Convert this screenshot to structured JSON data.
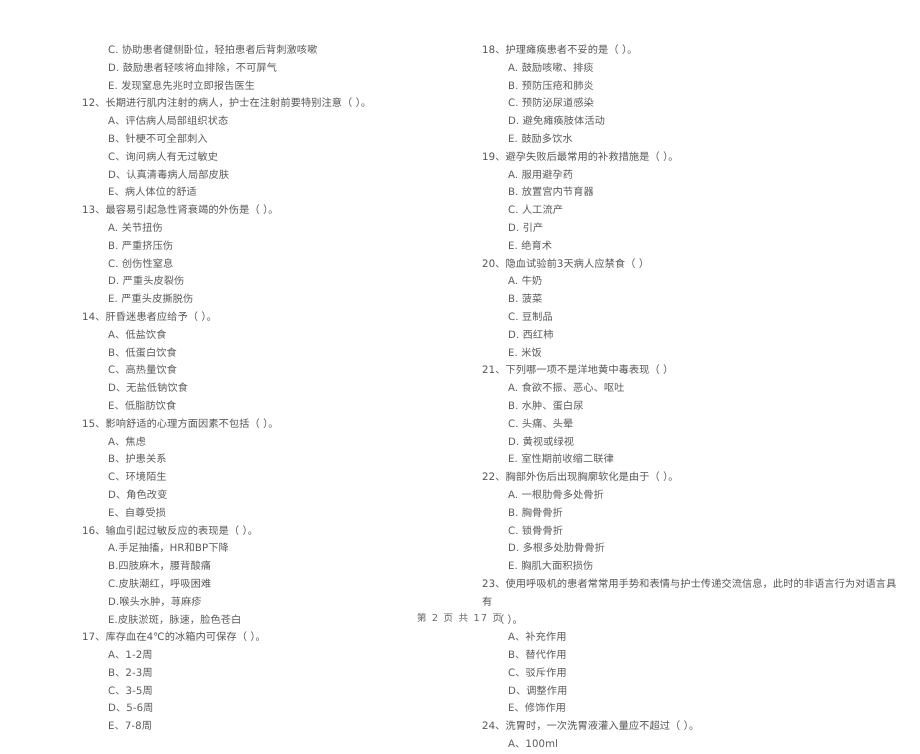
{
  "document": {
    "type": "scanned-exam-paper",
    "language": "zh-CN",
    "page_footer": "第 2 页  共 17 页",
    "background_color": "#ffffff",
    "text_color": "#4a4a4a"
  },
  "columns": [
    {
      "name": "left-column",
      "blocks": [
        {
          "kind": "orphan-options",
          "note": "continuation of question 11 from previous column/page",
          "options": [
            "C. 协助患者健侧卧位，轻拍患者后背刺激咳嗽",
            "D. 鼓励患者轻咳将血排除，不可屏气",
            "E. 发现窒息先兆时立即报告医生"
          ]
        },
        {
          "kind": "question",
          "number": "12",
          "stem": "12、长期进行肌内注射的病人，护士在注射前要特别注意（      ）。",
          "options": [
            "A、评估病人局部组织状态",
            "B、针梗不可全部刺入",
            "C、询问病人有无过敏史",
            "D、认真清毒病人局部皮肤",
            "E、病人体位的舒适"
          ]
        },
        {
          "kind": "question",
          "number": "13",
          "stem": "13、最容易引起急性肾衰竭的外伤是（      ）。",
          "options": [
            "A. 关节扭伤",
            "B. 严重挤压伤",
            "C. 创伤性窒息",
            "D. 严重头皮裂伤",
            "E. 严重头皮撕脱伤"
          ]
        },
        {
          "kind": "question",
          "number": "14",
          "stem": "14、肝昏迷患者应给予（      ）。",
          "options": [
            "A、低盐饮食",
            "B、低蛋白饮食",
            "C、高热量饮食",
            "D、无盐低钠饮食",
            "E、低脂肪饮食"
          ]
        },
        {
          "kind": "question",
          "number": "15",
          "stem": "15、影响舒适的心理方面因素不包括（      ）。",
          "options": [
            "A、焦虑",
            "B、护患关系",
            "C、环境陌生",
            "D、角色改变",
            "E、自尊受损"
          ]
        },
        {
          "kind": "question",
          "number": "16",
          "stem": "16、输血引起过敏反应的表现是（      ）。",
          "options": [
            "A.手足抽搐，HR和BP下降",
            "B.四肢麻木，腰背酸痛",
            "C.皮肤潮红，呼吸困难",
            "D.喉头水肿，荨麻疹",
            "E.皮肤淤斑，脉速，脸色苍白"
          ]
        },
        {
          "kind": "question",
          "number": "17",
          "stem": "17、库存血在4℃的冰箱内可保存（      ）。",
          "options": [
            "A、1-2周",
            "B、2-3周",
            "C、3-5周",
            "D、5-6周",
            "E、7-8周"
          ]
        }
      ]
    },
    {
      "name": "right-column",
      "blocks": [
        {
          "kind": "question",
          "number": "18",
          "stem": "18、护理瘫痪患者不妥的是（      ）。",
          "options": [
            "A. 鼓励咳嗽、排痰",
            "B. 预防压疮和肺炎",
            "C. 预防泌尿道感染",
            "D. 避免瘫痪肢体活动",
            "E. 鼓励多饮水"
          ]
        },
        {
          "kind": "question",
          "number": "19",
          "stem": "19、避孕失败后最常用的补救措施是（      ）。",
          "options": [
            "A. 服用避孕药",
            "B. 放置宫内节育器",
            "C. 人工流产",
            "D. 引产",
            "E. 绝育术"
          ]
        },
        {
          "kind": "question",
          "number": "20",
          "stem": "20、隐血试验前3天病人应禁食（      ）",
          "options": [
            "A. 牛奶",
            "B. 菠菜",
            "C. 豆制品",
            "D. 西红柿",
            "E. 米饭"
          ]
        },
        {
          "kind": "question",
          "number": "21",
          "stem": "21、下列哪一项不是洋地黄中毒表现（      ）",
          "options": [
            "A. 食欲不振、恶心、呕吐",
            "B. 水肿、蛋白尿",
            "C. 头痛、头晕",
            "D. 黄视或绿视",
            "E. 室性期前收缩二联律"
          ]
        },
        {
          "kind": "question",
          "number": "22",
          "stem": "22、胸部外伤后出现胸廓软化是由于（      ）。",
          "options": [
            "A. 一根肋骨多处骨折",
            "B. 胸骨骨折",
            "C. 锁骨骨折",
            "D. 多根多处肋骨骨折",
            "E. 胸肌大面积损伤"
          ]
        },
        {
          "kind": "question",
          "number": "23",
          "stem": "23、使用呼吸机的患者常常用手势和表情与护士传递交流信息，此时的非语言行为对语言具有",
          "stem_cont": "（      ）。",
          "options": [
            "A、补充作用",
            "B、替代作用",
            "C、驳斥作用",
            "D、调整作用",
            "E、修饰作用"
          ]
        },
        {
          "kind": "question",
          "number": "24",
          "stem": "24、洗胃时，一次洗胃液灌入量应不超过（      ）。",
          "options": [
            "A、100ml"
          ]
        }
      ]
    }
  ]
}
